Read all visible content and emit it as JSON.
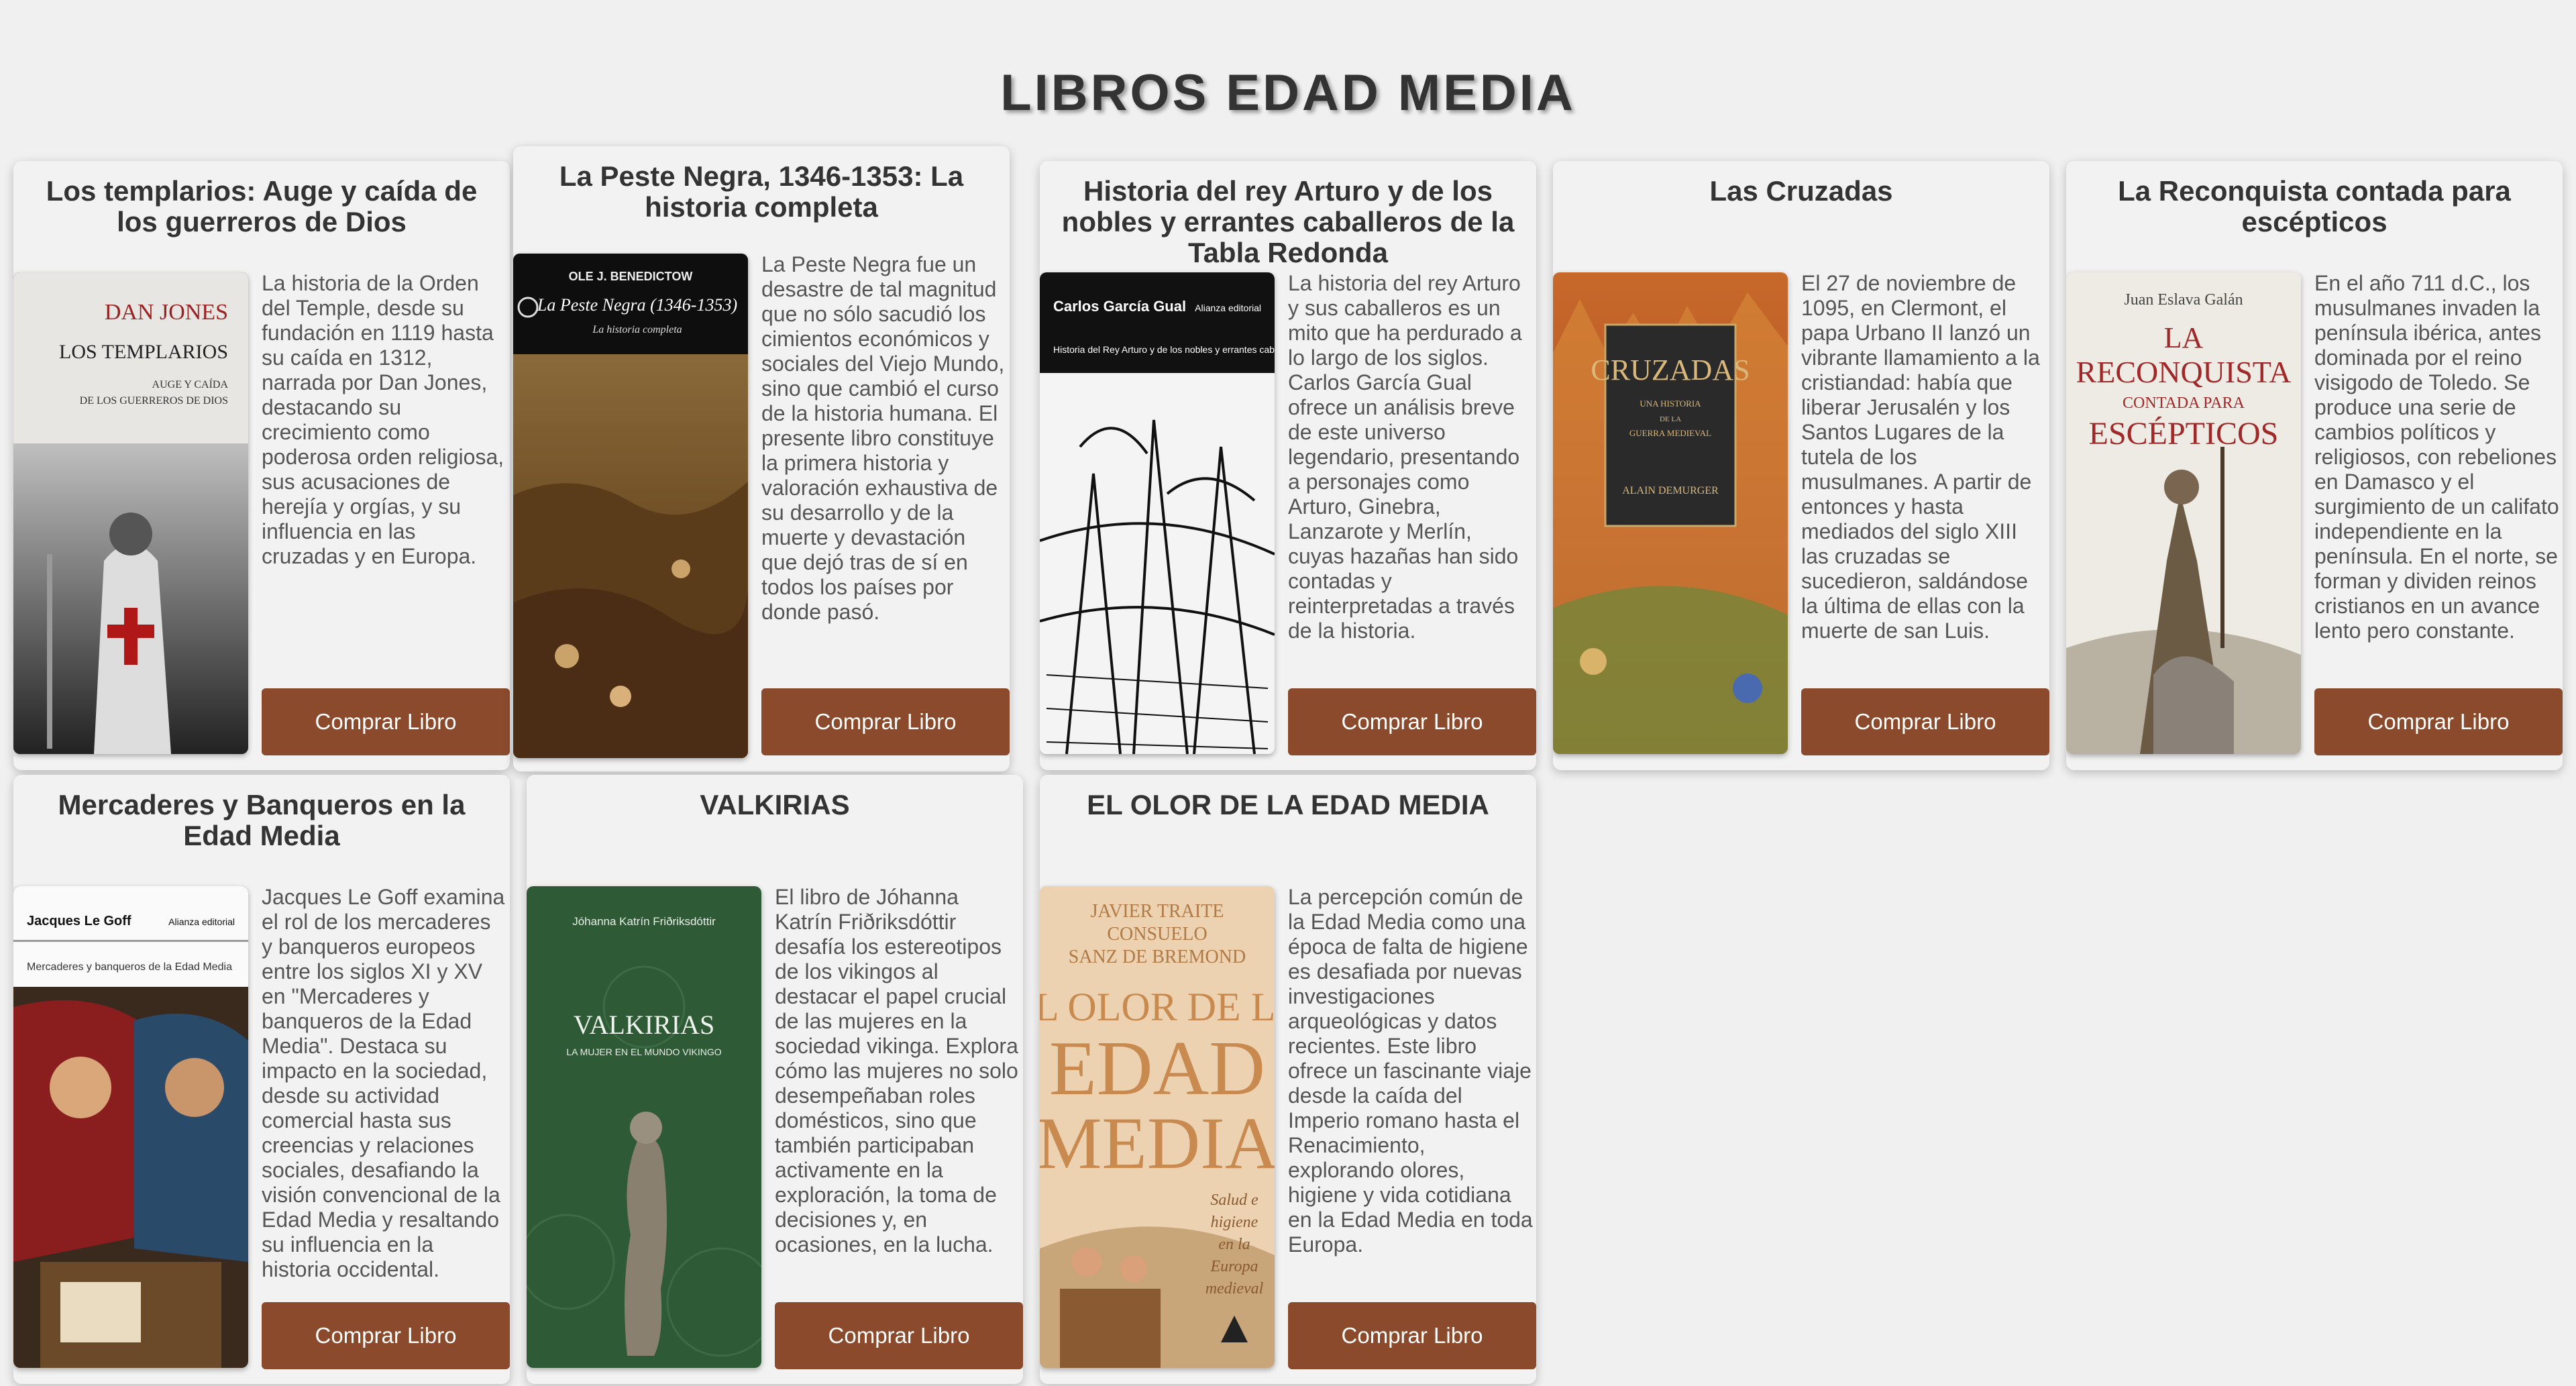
{
  "page": {
    "title": "LIBROS EDAD MEDIA"
  },
  "books": [
    {
      "title": "Los templarios: Auge y caída de los guerreros de Dios",
      "description": "La historia de la Orden del Temple, desde su fundación en 1119 hasta su caída en 1312, narrada por Dan Jones, destacando su crecimiento como poderosa orden religiosa, sus acusaciones de herejía y orgías, y su influencia en las cruzadas y en Europa.",
      "button": "Comprar Libro",
      "cover": {
        "author": "DAN JONES",
        "title": "LOS TEMPLARIOS",
        "subtitle1": "AUGE Y CAÍDA",
        "subtitle2": "DE LOS GUERREROS DE DIOS"
      }
    },
    {
      "title": "La Peste Negra, 1346-1353: La historia completa",
      "description": "La Peste Negra fue un desastre de tal magnitud que no sólo sacudió los cimientos económicos y sociales del Viejo Mundo, sino que cambió el curso de la historia humana. El presente libro constituye la primera historia y valoración exhaustiva de su desarrollo y de la muerte y devastación que dejó tras de sí en todos los países por donde pasó.",
      "button": "Comprar Libro",
      "cover": {
        "author": "OLE J. BENEDICTOW",
        "title": "La Peste Negra (1346-1353)",
        "subtitle": "La historia completa"
      }
    },
    {
      "title": "Historia del rey Arturo y de los nobles y errantes caballeros de la Tabla Redonda",
      "description": "La historia del rey Arturo y sus caballeros es un mito que ha perdurado a lo largo de los siglos. Carlos García Gual ofrece un análisis breve de este universo legendario, presentando a personajes como Arturo, Ginebra, Lanzarote y Merlín, cuyas hazañas han sido contadas y reinterpretadas a través de la historia.",
      "button": "Comprar Libro",
      "cover": {
        "author": "Carlos García Gual",
        "publisher": "Alianza editorial",
        "title": "Historia del Rey Arturo y de los nobles y errantes caballeros de la Tabla Redonda"
      }
    },
    {
      "title": "Las Cruzadas",
      "description": "El 27 de noviembre de 1095, en Clermont, el papa Urbano II lanzó un vibrante llamamiento a la cristiandad: había que liberar Jerusalén y los Santos Lugares de la tutela de los musulmanes. A partir de entonces y hasta mediados del siglo XIII las cruzadas se sucedieron, saldándose la última de ellas con la muerte de san Luis.",
      "button": "Comprar Libro",
      "cover": {
        "title": "CRUZADAS",
        "subtitle1": "UNA HISTORIA",
        "subtitle2": "DE LA",
        "subtitle3": "GUERRA MEDIEVAL",
        "author": "ALAIN DEMURGER"
      }
    },
    {
      "title": "La Reconquista contada para escépticos",
      "description": "En el año 711 d.C., los musulmanes invaden la península ibérica, antes dominada por el reino visigodo de Toledo. Se produce una serie de cambios políticos y religiosos, con rebeliones en Damasco y el surgimiento de un califato independiente en la península. En el norte, se forman y dividen reinos cristianos en un avance lento pero constante.",
      "button": "Comprar Libro",
      "cover": {
        "author": "Juan Eslava Galán",
        "title1": "LA",
        "title2": "RECONQUISTA",
        "title3": "CONTADA PARA",
        "title4": "ESCÉPTICOS"
      }
    },
    {
      "title": "Mercaderes y Banqueros en la Edad Media",
      "description": "Jacques Le Goff examina el rol de los mercaderes y banqueros europeos entre los siglos XI y XV en \"Mercaderes y banqueros de la Edad Media\". Destaca su impacto en la sociedad, desde su actividad comercial hasta sus creencias y relaciones sociales, desafiando la visión convencional de la Edad Media y resaltando su influencia en la historia occidental.",
      "button": "Comprar Libro",
      "cover": {
        "author": "Jacques Le Goff",
        "publisher": "Alianza editorial",
        "title": "Mercaderes y banqueros de la Edad Media"
      }
    },
    {
      "title": "VALKIRIAS",
      "description": "El libro de Jóhanna Katrín Friðriksdóttir desafía los estereotipos de los vikingos al destacar el papel crucial de las mujeres en la sociedad vikinga. Explora cómo las mujeres no solo desempeñaban roles domésticos, sino que también participaban activamente en la exploración, la toma de decisiones y, en ocasiones, en la lucha.",
      "button": "Comprar Libro",
      "cover": {
        "author": "Jóhanna Katrín Friðriksdóttir",
        "title": "VALKIRIAS",
        "subtitle": "LA MUJER EN EL MUNDO VIKINGO"
      }
    },
    {
      "title": "EL OLOR DE LA EDAD MEDIA",
      "description": "La percepción común de la Edad Media como una época de falta de higiene es desafiada por nuevas investigaciones arqueológicas y datos recientes. Este libro ofrece un fascinante viaje desde la caída del Imperio romano hasta el Renacimiento, explorando olores, higiene y vida cotidiana en la Edad Media en toda Europa.",
      "button": "Comprar Libro",
      "cover": {
        "author1": "JAVIER TRAITE",
        "author2": "CONSUELO",
        "author3": "SANZ DE BREMOND",
        "title1": "EL OLOR DE LA",
        "title2": "EDAD",
        "title3": "MEDIA",
        "subtitle1": "Salud e",
        "subtitle2": "higiene",
        "subtitle3": "en la",
        "subtitle4": "Europa",
        "subtitle5": "medieval"
      }
    }
  ],
  "colors": {
    "button": "#8b4a2b",
    "background": "#f0f0f0",
    "card": "#f2f2f2"
  }
}
